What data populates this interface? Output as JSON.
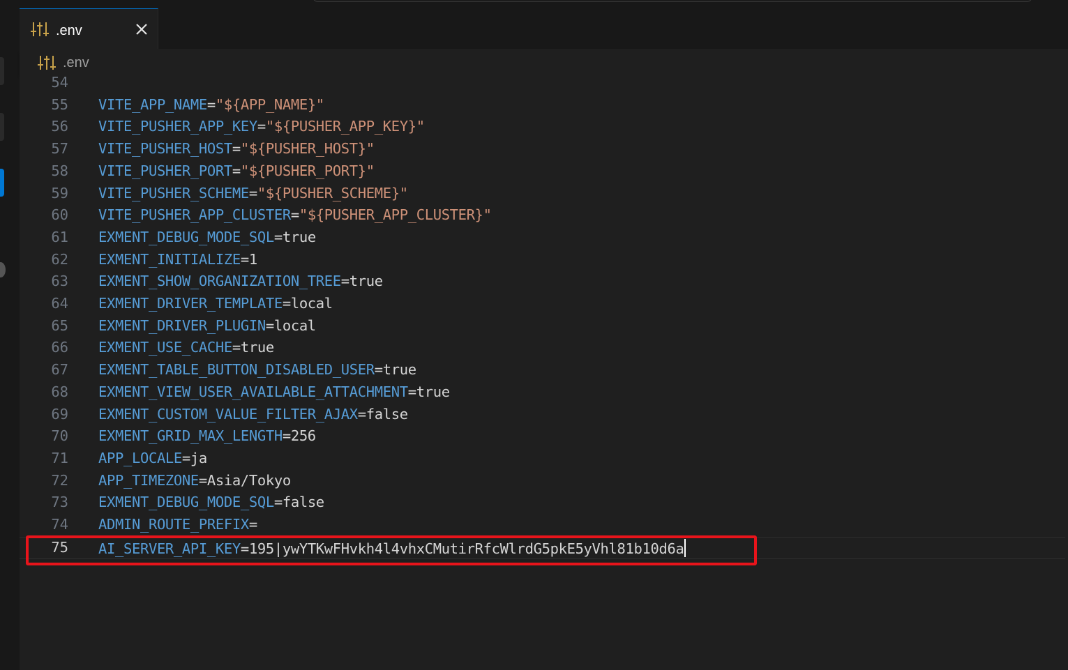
{
  "tab": {
    "label": ".env",
    "icon": "settings-sliders-icon",
    "close_icon": "close-icon"
  },
  "breadcrumb": {
    "label": ".env",
    "icon": "settings-sliders-icon"
  },
  "colors": {
    "key": "#569cd6",
    "string": "#ce9178",
    "value": "#d4d4d4",
    "highlight": "#e8141b",
    "accent": "#0078d4"
  },
  "editor": {
    "current_line": 75,
    "lines": [
      {
        "n": "54",
        "key": "",
        "eq": "",
        "str": "",
        "val": ""
      },
      {
        "n": "55",
        "key": "VITE_APP_NAME",
        "eq": "=",
        "str": "\"${APP_NAME}\"",
        "val": ""
      },
      {
        "n": "56",
        "key": "VITE_PUSHER_APP_KEY",
        "eq": "=",
        "str": "\"${PUSHER_APP_KEY}\"",
        "val": ""
      },
      {
        "n": "57",
        "key": "VITE_PUSHER_HOST",
        "eq": "=",
        "str": "\"${PUSHER_HOST}\"",
        "val": ""
      },
      {
        "n": "58",
        "key": "VITE_PUSHER_PORT",
        "eq": "=",
        "str": "\"${PUSHER_PORT}\"",
        "val": ""
      },
      {
        "n": "59",
        "key": "VITE_PUSHER_SCHEME",
        "eq": "=",
        "str": "\"${PUSHER_SCHEME}\"",
        "val": ""
      },
      {
        "n": "60",
        "key": "VITE_PUSHER_APP_CLUSTER",
        "eq": "=",
        "str": "\"${PUSHER_APP_CLUSTER}\"",
        "val": ""
      },
      {
        "n": "61",
        "key": "EXMENT_DEBUG_MODE_SQL",
        "eq": "=",
        "str": "",
        "val": "true"
      },
      {
        "n": "62",
        "key": "EXMENT_INITIALIZE",
        "eq": "=",
        "str": "",
        "val": "1"
      },
      {
        "n": "63",
        "key": "EXMENT_SHOW_ORGANIZATION_TREE",
        "eq": "=",
        "str": "",
        "val": "true"
      },
      {
        "n": "64",
        "key": "EXMENT_DRIVER_TEMPLATE",
        "eq": "=",
        "str": "",
        "val": "local"
      },
      {
        "n": "65",
        "key": "EXMENT_DRIVER_PLUGIN",
        "eq": "=",
        "str": "",
        "val": "local"
      },
      {
        "n": "66",
        "key": "EXMENT_USE_CACHE",
        "eq": "=",
        "str": "",
        "val": "true"
      },
      {
        "n": "67",
        "key": "EXMENT_TABLE_BUTTON_DISABLED_USER",
        "eq": "=",
        "str": "",
        "val": "true"
      },
      {
        "n": "68",
        "key": "EXMENT_VIEW_USER_AVAILABLE_ATTACHMENT",
        "eq": "=",
        "str": "",
        "val": "true"
      },
      {
        "n": "69",
        "key": "EXMENT_CUSTOM_VALUE_FILTER_AJAX",
        "eq": "=",
        "str": "",
        "val": "false"
      },
      {
        "n": "70",
        "key": "EXMENT_GRID_MAX_LENGTH",
        "eq": "=",
        "str": "",
        "val": "256"
      },
      {
        "n": "71",
        "key": "APP_LOCALE",
        "eq": "=",
        "str": "",
        "val": "ja"
      },
      {
        "n": "72",
        "key": "APP_TIMEZONE",
        "eq": "=",
        "str": "",
        "val": "Asia/Tokyo"
      },
      {
        "n": "73",
        "key": "EXMENT_DEBUG_MODE_SQL",
        "eq": "=",
        "str": "",
        "val": "false"
      },
      {
        "n": "74",
        "key": "ADMIN_ROUTE_PREFIX",
        "eq": "=",
        "str": "",
        "val": ""
      },
      {
        "n": "75",
        "key": "AI_SERVER_API_KEY",
        "eq": "=",
        "str": "",
        "val": "195|ywYTKwFHvkh4l4vhxCMutirRfcWlrdG5pkE5yVhl81b10d6a"
      }
    ]
  }
}
